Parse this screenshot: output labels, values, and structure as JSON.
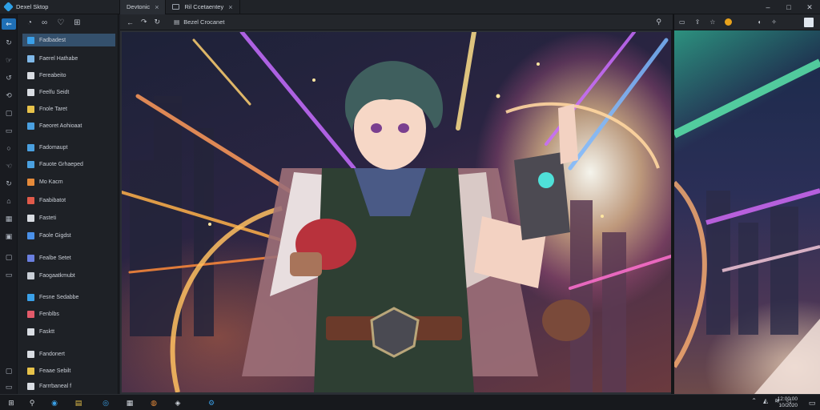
{
  "app": {
    "title": "Dexel Sktop"
  },
  "tabs": [
    {
      "label": "Devtonic",
      "active": true
    },
    {
      "label": "Ril Ccetaentey",
      "active": false
    }
  ],
  "address": {
    "label": "Bezel Crocanet"
  },
  "sidebar": {
    "items": [
      {
        "label": "Fadbadest",
        "selected": true,
        "color": "#3aa0e8"
      },
      {
        "label": "Faerel Hathabe",
        "color": "#7fb8e8"
      },
      {
        "label": "Fereabeito",
        "color": "#d9dde3"
      },
      {
        "label": "Feelfu Seidt",
        "color": "#d9dde3"
      },
      {
        "label": "Fnole Taret",
        "color": "#e7c24a"
      },
      {
        "label": "Faeoret Aohioaat",
        "color": "#4aa0e0"
      },
      {
        "label": "Fadomaupt",
        "color": "#4aa0e0"
      },
      {
        "label": "Fauote Grhaeped",
        "color": "#4aa0e0"
      },
      {
        "label": "Mo Kacm",
        "color": "#e58a3a"
      },
      {
        "label": "Faabibatot",
        "color": "#e05a4a"
      },
      {
        "label": "Fasteti",
        "color": "#d9dde3"
      },
      {
        "label": "Faole Gigdst",
        "color": "#4a90e8"
      },
      {
        "label": "Fealbe Setet",
        "color": "#6a7fe0"
      },
      {
        "label": "Faogaatkmubt",
        "color": "#c9cfd7"
      },
      {
        "label": "Fesne Sedabbe",
        "color": "#3aa0e8"
      },
      {
        "label": "Fenblbs",
        "color": "#e35a6a"
      },
      {
        "label": "Fasktt",
        "color": "#d9dde3"
      },
      {
        "label": "Fandonert",
        "color": "#d9dde3"
      },
      {
        "label": "Feaae Sebilt",
        "color": "#e7c24a"
      },
      {
        "label": "Farrrbaneal f",
        "color": "#d9dde3"
      }
    ]
  },
  "clock": {
    "time": "12:00:00",
    "date": "10/2020"
  },
  "colors": {
    "accent": "#1f6fb5",
    "selection": "#34506c"
  }
}
